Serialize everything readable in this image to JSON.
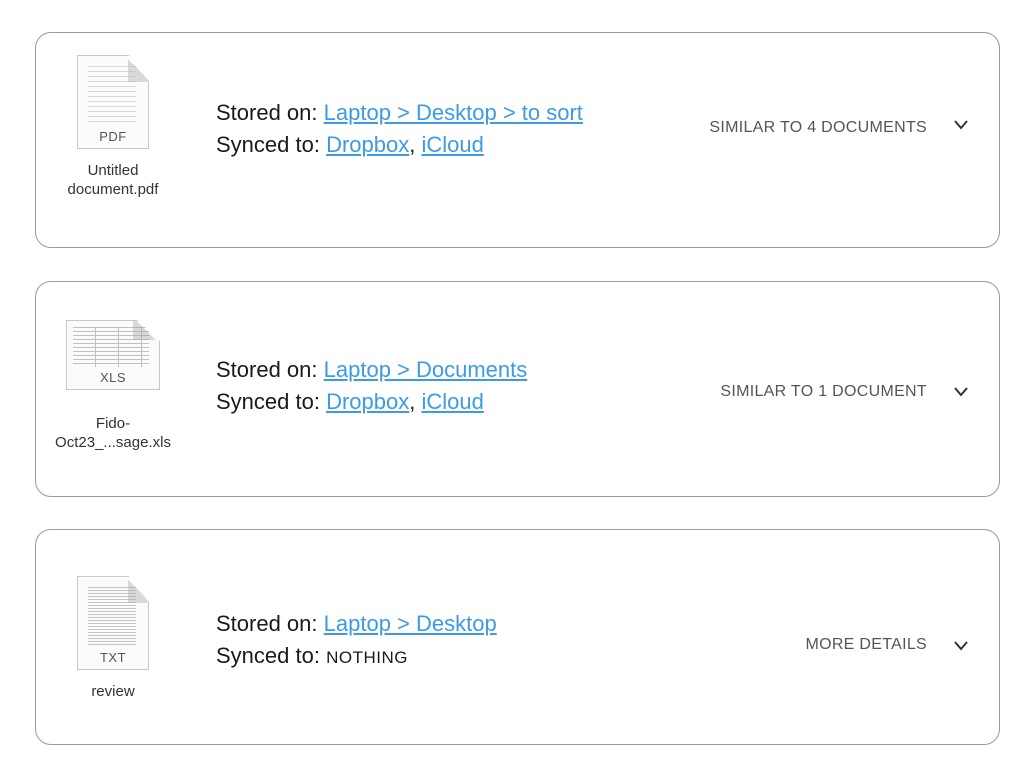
{
  "documents": [
    {
      "file_name": "Untitled document.pdf",
      "file_ext": "PDF",
      "icon": "pdf-document-icon",
      "stored_label": "Stored on: ",
      "stored_path": "Laptop > Desktop > to sort",
      "synced_label": "Synced to: ",
      "synced_targets": [
        "Dropbox",
        "iCloud"
      ],
      "action_label": "SIMILAR TO 4 DOCUMENTS"
    },
    {
      "file_name": "Fido-Oct23_...sage.xls",
      "file_ext": "XLS",
      "icon": "xls-spreadsheet-icon",
      "stored_label": "Stored on: ",
      "stored_path": "Laptop > Documents",
      "synced_label": "Synced to: ",
      "synced_targets": [
        "Dropbox",
        "iCloud"
      ],
      "action_label": "SIMILAR TO 1 DOCUMENT"
    },
    {
      "file_name": "review",
      "file_ext": "TXT",
      "icon": "txt-document-icon",
      "stored_label": "Stored on: ",
      "stored_path": "Laptop > Desktop",
      "synced_label": "Synced to: ",
      "synced_nothing": "NOTHING",
      "action_label": "MORE DETAILS"
    }
  ],
  "separator": ", ",
  "colors": {
    "link": "#3b9be6",
    "border": "#9a9a9a",
    "action_text": "#555555"
  }
}
